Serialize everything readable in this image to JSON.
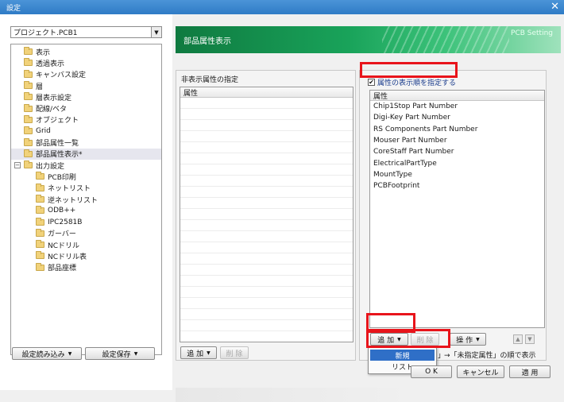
{
  "window": {
    "title": "設定",
    "close_glyph": "✕"
  },
  "project_combo": {
    "value": "プロジェクト.PCB1",
    "arrow": "▼"
  },
  "tree": {
    "items": [
      {
        "label": "表示",
        "level": 0
      },
      {
        "label": "透過表示",
        "level": 0
      },
      {
        "label": "キャンバス設定",
        "level": 0
      },
      {
        "label": "層",
        "level": 0
      },
      {
        "label": "層表示設定",
        "level": 0
      },
      {
        "label": "配線/ベタ",
        "level": 0
      },
      {
        "label": "オブジェクト",
        "level": 0
      },
      {
        "label": "Grid",
        "level": 0
      },
      {
        "label": "部品属性一覧",
        "level": 0
      },
      {
        "label": "部品属性表示*",
        "level": 0,
        "selected": true
      },
      {
        "label": "出力設定",
        "level": 0,
        "expander": "−"
      },
      {
        "label": "PCB印刷",
        "level": 1
      },
      {
        "label": "ネットリスト",
        "level": 1
      },
      {
        "label": "逆ネットリスト",
        "level": 1
      },
      {
        "label": "ODB++",
        "level": 1
      },
      {
        "label": "IPC2581B",
        "level": 1
      },
      {
        "label": "ガーバー",
        "level": 1
      },
      {
        "label": "NCドリル",
        "level": 1
      },
      {
        "label": "NCドリル表",
        "level": 1
      },
      {
        "label": "部品座標",
        "level": 1
      }
    ]
  },
  "left_buttons": {
    "load": "設定読み込み",
    "save": "設定保存",
    "dd": "▼"
  },
  "banner": {
    "title": "部品属性表示",
    "subtitle": "PCB Setting"
  },
  "hidden_group": {
    "label": "非表示属性の指定",
    "header": "属性",
    "add": "追 加",
    "delete": "削 除",
    "dd": "▼"
  },
  "order_group": {
    "checkbox_label": "属性の表示順を指定する",
    "check_glyph": "✔",
    "header": "属性",
    "items": [
      "Chip1Stop Part Number",
      "Digi-Key Part Number",
      "RS Components Part Number",
      "Mouser Part Number",
      "CoreStaff Part Number",
      "ElectricalPartType",
      "MountType",
      "PCBFootprint"
    ],
    "add": "追 加",
    "delete": "削 除",
    "operation": "操 作",
    "dd": "▼",
    "up": "▲",
    "down": "▼"
  },
  "dropdown_menu": {
    "items": [
      "新規",
      "リスト"
    ]
  },
  "note": {
    "text_left": "」",
    "text_right": "→「未指定属性」の順で表示"
  },
  "footer": {
    "ok": "O K",
    "cancel": "キャンセル",
    "apply": "適 用"
  }
}
